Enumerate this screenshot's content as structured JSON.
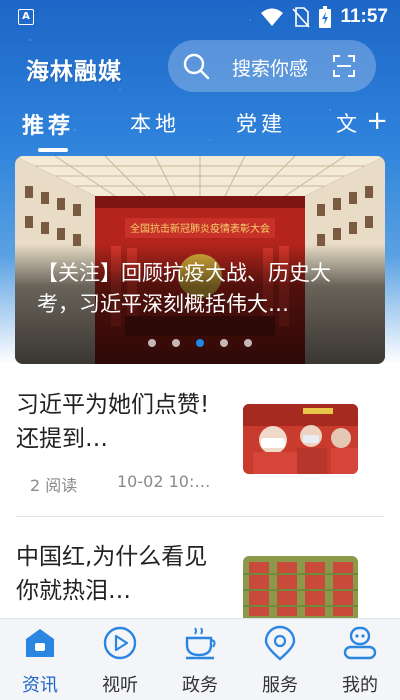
{
  "status_bar": {
    "app_icon_letter": "A",
    "time": "11:57"
  },
  "header": {
    "logo": "海林融媒",
    "search_placeholder": "搜索你感",
    "tabs": [
      {
        "label": "推荐",
        "active": true
      },
      {
        "label": "本地",
        "active": false
      },
      {
        "label": "党建",
        "active": false
      },
      {
        "label": "文",
        "active": false
      }
    ],
    "add_tab": "+"
  },
  "carousel": {
    "banner_text": "全国抗击新冠肺炎疫情表彰大会",
    "title": "【关注】回顾抗疫大战、历史大考，习近平深刻概括伟大…",
    "dot_count": 5,
    "active_dot": 3
  },
  "news": [
    {
      "title": "习近平为她们点赞!还提到…",
      "reads": "2 阅读",
      "date": "10-02 10:…"
    },
    {
      "title": "中国红,为什么看见你就热泪…",
      "reads": "",
      "date": ""
    }
  ],
  "bottom_nav": [
    {
      "label": "资讯",
      "icon": "news-icon",
      "active": true
    },
    {
      "label": "视听",
      "icon": "play-icon",
      "active": false
    },
    {
      "label": "政务",
      "icon": "cup-icon",
      "active": false
    },
    {
      "label": "服务",
      "icon": "location-icon",
      "active": false
    },
    {
      "label": "我的",
      "icon": "profile-icon",
      "active": false
    }
  ],
  "colors": {
    "primary": "#1d66c7",
    "active_dot": "#1e88e5",
    "nav_bg": "#f3f5f8"
  }
}
